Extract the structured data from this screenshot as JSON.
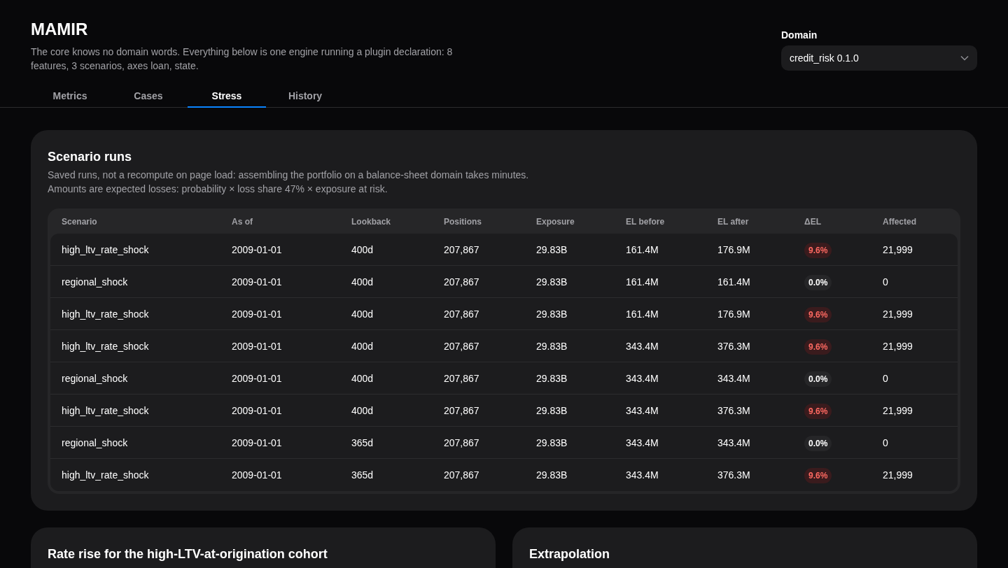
{
  "app": {
    "title": "MAMIR",
    "description": "The core knows no domain words. Everything below is one engine running a plugin declaration: 8 features, 3 scenarios, axes loan, state."
  },
  "domain": {
    "label": "Domain",
    "value": "credit_risk 0.1.0"
  },
  "tabs": [
    {
      "label": "Metrics",
      "selected": false
    },
    {
      "label": "Cases",
      "selected": false
    },
    {
      "label": "Stress",
      "selected": true
    },
    {
      "label": "History",
      "selected": false
    }
  ],
  "scenario_runs": {
    "title": "Scenario runs",
    "notes": [
      "Saved runs, not a recompute on page load: assembling the portfolio on a balance-sheet domain takes minutes.",
      "Amounts are expected losses: probability × loss share 47% × exposure at risk."
    ],
    "columns": [
      "Scenario",
      "As of",
      "Lookback",
      "Positions",
      "Exposure",
      "EL before",
      "EL after",
      "ΔEL",
      "Affected"
    ],
    "rows": [
      {
        "cells": [
          "high_ltv_rate_shock",
          "2009-01-01",
          "400d",
          "207,867",
          "29.83B",
          "161.4M",
          "176.9M"
        ],
        "delta": {
          "text": "9.6%",
          "kind": "increase"
        },
        "affected": "21,999"
      },
      {
        "cells": [
          "regional_shock",
          "2009-01-01",
          "400d",
          "207,867",
          "29.83B",
          "161.4M",
          "161.4M"
        ],
        "delta": {
          "text": "0.0%",
          "kind": "zero"
        },
        "affected": "0"
      },
      {
        "cells": [
          "high_ltv_rate_shock",
          "2009-01-01",
          "400d",
          "207,867",
          "29.83B",
          "161.4M",
          "176.9M"
        ],
        "delta": {
          "text": "9.6%",
          "kind": "increase"
        },
        "affected": "21,999"
      },
      {
        "cells": [
          "high_ltv_rate_shock",
          "2009-01-01",
          "400d",
          "207,867",
          "29.83B",
          "343.4M",
          "376.3M"
        ],
        "delta": {
          "text": "9.6%",
          "kind": "increase"
        },
        "affected": "21,999"
      },
      {
        "cells": [
          "regional_shock",
          "2009-01-01",
          "400d",
          "207,867",
          "29.83B",
          "343.4M",
          "343.4M"
        ],
        "delta": {
          "text": "0.0%",
          "kind": "zero"
        },
        "affected": "0"
      },
      {
        "cells": [
          "high_ltv_rate_shock",
          "2009-01-01",
          "400d",
          "207,867",
          "29.83B",
          "343.4M",
          "376.3M"
        ],
        "delta": {
          "text": "9.6%",
          "kind": "increase"
        },
        "affected": "21,999"
      },
      {
        "cells": [
          "regional_shock",
          "2009-01-01",
          "365d",
          "207,867",
          "29.83B",
          "343.4M",
          "343.4M"
        ],
        "delta": {
          "text": "0.0%",
          "kind": "zero"
        },
        "affected": "0"
      },
      {
        "cells": [
          "high_ltv_rate_shock",
          "2009-01-01",
          "365d",
          "207,867",
          "29.83B",
          "343.4M",
          "376.3M"
        ],
        "delta": {
          "text": "9.6%",
          "kind": "increase"
        },
        "affected": "21,999"
      }
    ]
  },
  "panels": [
    {
      "title": "Rate rise for the high-LTV-at-origination cohort"
    },
    {
      "title": "Extrapolation"
    }
  ]
}
